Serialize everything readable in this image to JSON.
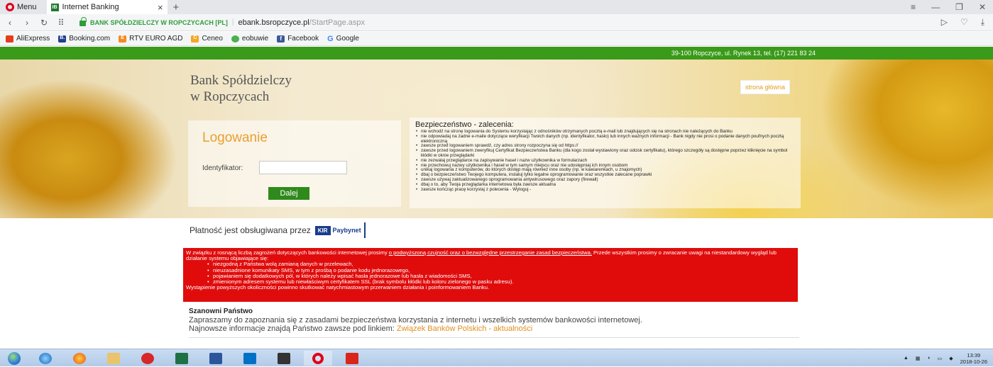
{
  "browser": {
    "menu_label": "Menu",
    "tab_title": "Internet Banking",
    "tab_favicon": "IB",
    "site_identity": "BANK SPÓŁDZIELCZY W ROPCZYCACH [PL]",
    "url_domain": "ebank.bsropczyce.pl",
    "url_path": "/StartPage.aspx",
    "bookmarks": [
      {
        "label": "AliExpress",
        "color": "#e43d1c"
      },
      {
        "label": "Booking.com",
        "color": "#1f3f8f"
      },
      {
        "label": "RTV EURO AGD",
        "color": "#f58a1f"
      },
      {
        "label": "Ceneo",
        "color": "#f5a623"
      },
      {
        "label": "eobuwie",
        "color": "#4caf50"
      },
      {
        "label": "Facebook",
        "color": "#3b5998"
      },
      {
        "label": "Google",
        "color": "#4285f4"
      }
    ],
    "booking_badge": "B.",
    "rtv_badge": "E",
    "ceneo_badge": "C",
    "facebook_badge": "f",
    "google_badge": "G"
  },
  "page": {
    "address_bar": "39-100 Ropczyce, ul. Rynek 13, tel. (17) 221 83 24",
    "bank_name_line1": "Bank Spółdzielczy",
    "bank_name_line2": "w Ropczycach",
    "home_link": "strona główna",
    "login": {
      "title": "Logowanie",
      "label": "Identyfikator:",
      "input_value": "",
      "button": "Dalej"
    },
    "security": {
      "title": "Bezpieczeństwo - zalecenia:",
      "items": [
        "nie wchodź na stronę logowania do Systemu korzystając z odnośników otrzymanych pocztą e-mail lub znajdujących się na stronach nie należących do Banku",
        "nie odpowiadaj na żadne e-maile dotyczące weryfikacji Twoich danych (np. identyfikator, hasło) lub innych ważnych informacji - Bank nigdy nie prosi o podanie danych poufnych pocztą elektroniczną",
        "zawsze przed logowaniem sprawdź, czy adres strony rozpoczyna się od https://",
        "zawsze przed logowaniem zweryfikuj Certyfikat Bezpieczeństwa Banku (dla kogo został wystawiony oraz odcisk certyfikatu), którego szczegóły są dostępne poprzez kliknięcie na symbol kłódki w oknie przeglądarki",
        "nie zezwalaj przeglądarce na zapisywanie haseł i nazw użytkownika w formularzach",
        "nie przechowuj nazwy użytkownika i haseł w tym samym miejscu oraz nie udostępniaj ich innym osobom",
        "unikaj logowania z komputerów, do których dostęp mają również inne osoby (np. w kawiarenkach, u znajomych)",
        "dbaj o bezpieczeństwo Twojego komputera, instaluj tylko legalne oprogramowanie oraz wszystkie zalecane poprawki",
        "zawsze używaj zaktualizowanego oprogramowania antywirusowego oraz zapory (firewall)",
        "dbaj o to, aby Twoja przeglądarka internetowa była zawsze aktualna",
        "zawsze kończąc pracę korzystaj z polecenia - Wyloguj -"
      ]
    },
    "payment": {
      "text": "Płatność jest obsługiwana przez",
      "kir": "KIR",
      "paybynet": "Paybynet"
    },
    "alert": {
      "intro_before": "W związku z rosnącą liczbą zagrożeń dotyczących bankowości internetowej prosimy ",
      "intro_link": "o podwyższoną czujność oraz o bezwzględne przestrzeganie zasad bezpieczeństwa.",
      "intro_after": " Przede wszystkim prosimy o zwracanie uwagi na niestandardowy wygląd lub działanie systemu objawiające się:",
      "items": [
        "niezgodną z Państwa wolą zamianą danych w przelewach,",
        "nieuzasadnione komunikaty SMS, w tym z prośbą o podanie kodu jednorazowego,",
        "pojawianiem się dodatkowych pól, w których należy wpisać hasła jednorazowe lub hasła z wiadomości SMS,",
        "zmienionym adresem systemu lub niewłaściwym certyfikatem SSL (brak symbolu kłódki lub koloru zielonego w pasku adresu)."
      ],
      "outro": "Wystąpienie powyższych okoliczności powinno skutkować natychmiastowym przerwaniem działania i poinformowaniem Banku."
    },
    "welcome": {
      "title": "Szanowni Państwo",
      "line1": "Zapraszamy do zapoznania się z zasadami bezpieczeństwa korzystania z internetu i wszelkich systemów bankowości internetowej.",
      "line2": "Najnowsze informacje znajdą Państwo zawsze pod linkiem: ",
      "link": "Związek Banków Polskich - aktualności"
    }
  },
  "taskbar": {
    "time": "13:39",
    "date": "2018-10-26"
  }
}
